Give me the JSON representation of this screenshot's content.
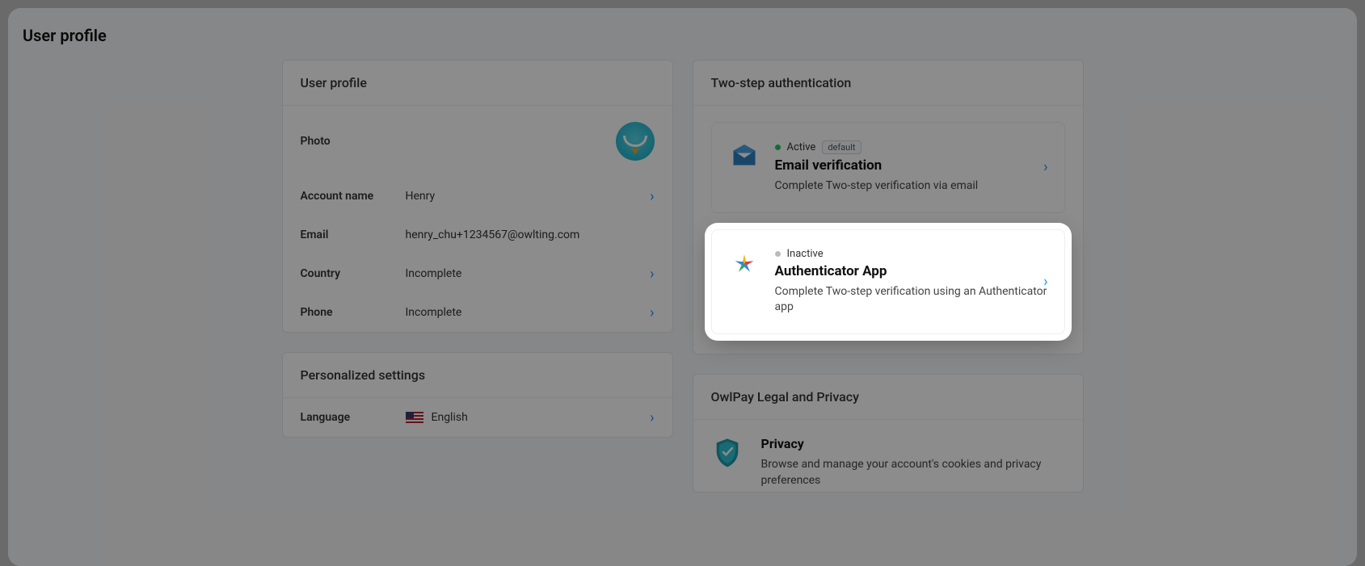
{
  "header": {
    "title": "User profile"
  },
  "profile": {
    "title": "User profile",
    "photo_label": "Photo",
    "fields": {
      "account_name": {
        "label": "Account name",
        "value": "Henry"
      },
      "email": {
        "label": "Email",
        "value": "henry_chu+1234567@owlting.com"
      },
      "country": {
        "label": "Country",
        "value": "Incomplete"
      },
      "phone": {
        "label": "Phone",
        "value": "Incomplete"
      }
    }
  },
  "personalized": {
    "title": "Personalized settings",
    "language": {
      "label": "Language",
      "value": "English"
    }
  },
  "two_step": {
    "title": "Two-step authentication",
    "email": {
      "status": "Active",
      "pill": "default",
      "title": "Email verification",
      "desc": "Complete Two-step verification via email"
    },
    "authenticator": {
      "status": "Inactive",
      "title": "Authenticator App",
      "desc": "Complete Two-step verification using an Authenticator app"
    }
  },
  "legal": {
    "title": "OwlPay Legal and Privacy",
    "privacy": {
      "title": "Privacy",
      "desc": "Browse and manage your account's cookies and privacy preferences"
    }
  }
}
